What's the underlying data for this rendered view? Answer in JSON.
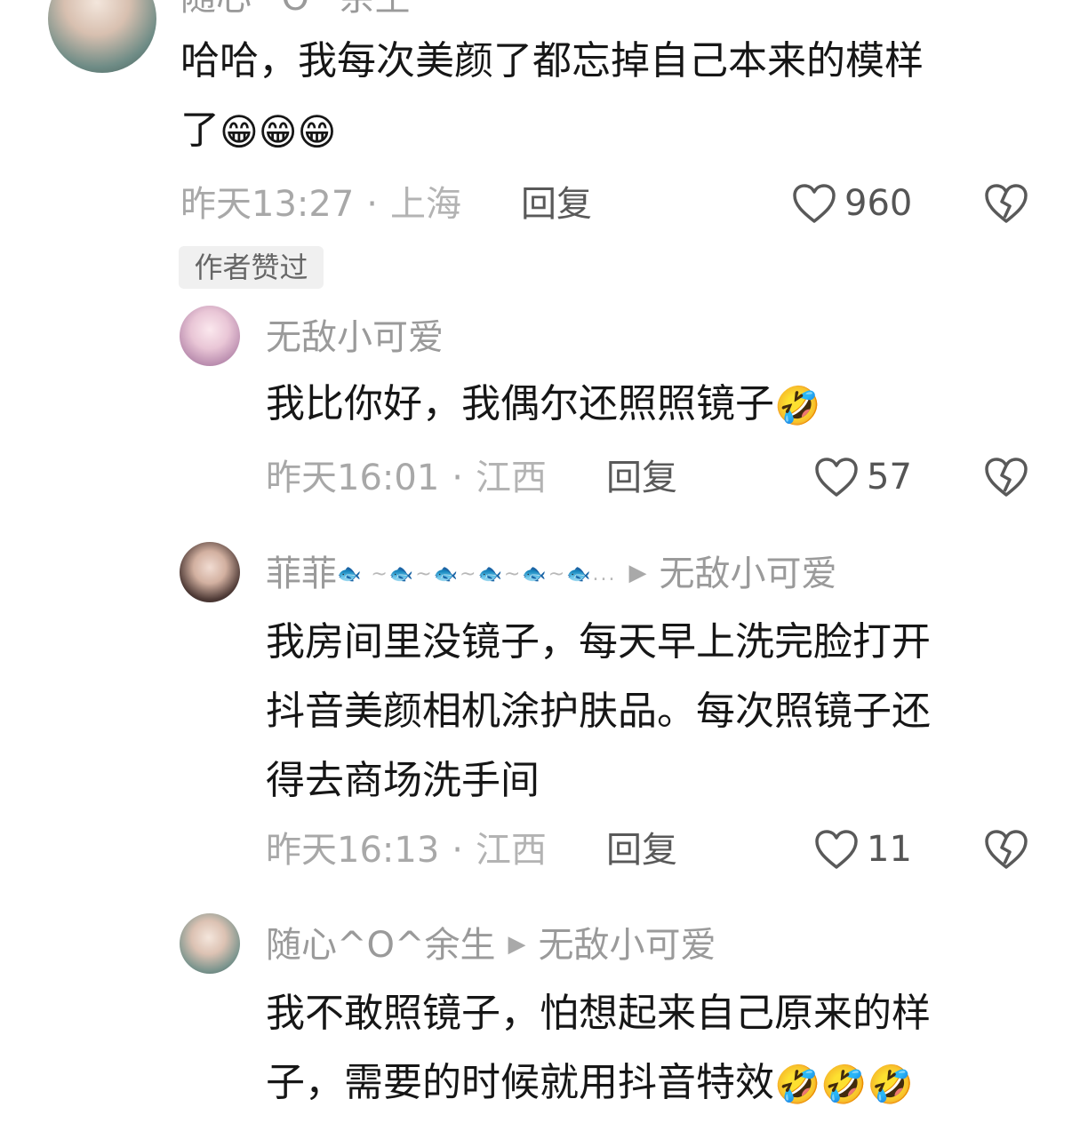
{
  "main_comment": {
    "author_partial": "随心^O^余生",
    "text_line1": "哈哈，我每次美颜了都忘掉自己本来的模样",
    "text_line2": "了",
    "emojis": [
      "😁",
      "😁",
      "😁"
    ],
    "time": "昨天13:27",
    "region": "上海",
    "reply_label": "回复",
    "likes": "960",
    "badge": "作者赞过"
  },
  "replies": [
    {
      "author": "无敌小可爱",
      "reply_to": "",
      "text_lines": [
        "我比你好，我偶尔还照照镜子"
      ],
      "emojis": [
        "🤣"
      ],
      "time": "昨天16:01",
      "region": "江西",
      "reply_label": "回复",
      "likes": "57"
    },
    {
      "author": "菲菲",
      "author_decor": "🐟 ~🐟~🐟~🐟~🐟~🐟...",
      "reply_to": "无敌小可爱",
      "text_lines": [
        "我房间里没镜子，每天早上洗完脸打开",
        "抖音美颜相机涂护肤品。每次照镜子还",
        "得去商场洗手间"
      ],
      "emojis": [],
      "time": "昨天16:13",
      "region": "江西",
      "reply_label": "回复",
      "likes": "11"
    },
    {
      "author": "随心^O^余生",
      "reply_to": "无敌小可爱",
      "text_lines": [
        "我不敢照镜子，怕想起来自己原来的样",
        "子，需要的时候就用抖音特效"
      ],
      "emojis": [
        "🤣",
        "🤣",
        "🤣"
      ],
      "time": "",
      "region": "",
      "reply_label": "",
      "likes": ""
    }
  ],
  "icons": {
    "like": "heart-outline-icon",
    "dislike": "broken-heart-icon",
    "reply_arrow": "play-triangle-icon"
  },
  "colors": {
    "text": "#161616",
    "meta": "#a8a8a8",
    "name": "#9a9a9a",
    "badge_bg": "#f0f0f0"
  }
}
